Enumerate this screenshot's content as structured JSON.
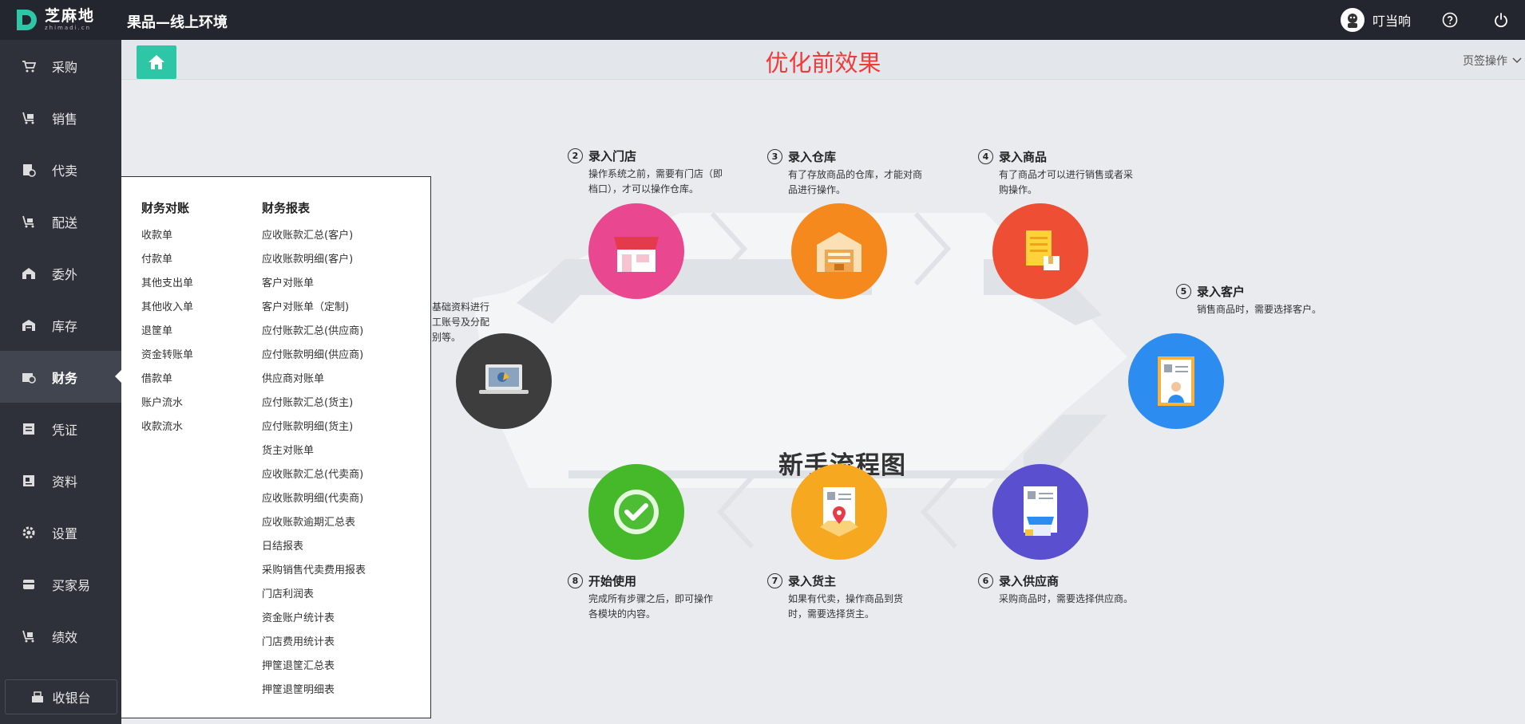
{
  "app": {
    "logo_cn": "芝麻地",
    "logo_en": "zhimadi.cn",
    "title": "果品—线上环境",
    "user_name": "叮当响",
    "accent_color": "#2dc6a7"
  },
  "sidebar": {
    "items": [
      {
        "label": "采购",
        "icon": "cart-icon"
      },
      {
        "label": "销售",
        "icon": "trolley-icon"
      },
      {
        "label": "代卖",
        "icon": "consign-icon"
      },
      {
        "label": "配送",
        "icon": "delivery-icon"
      },
      {
        "label": "委外",
        "icon": "outsource-icon"
      },
      {
        "label": "库存",
        "icon": "warehouse-icon"
      },
      {
        "label": "财务",
        "icon": "finance-icon",
        "active": true
      },
      {
        "label": "凭证",
        "icon": "voucher-icon"
      },
      {
        "label": "资料",
        "icon": "data-icon"
      },
      {
        "label": "设置",
        "icon": "gear-icon"
      },
      {
        "label": "买家易",
        "icon": "buyer-icon"
      },
      {
        "label": "绩效",
        "icon": "performance-icon"
      }
    ],
    "footer_label": "收银台"
  },
  "tabbar": {
    "heading": "优化前效果",
    "ops_label": "页签操作"
  },
  "finance_menu": {
    "col1": {
      "title": "财务对账",
      "items": [
        "收款单",
        "付款单",
        "其他支出单",
        "其他收入单",
        "退筐单",
        "资金转账单",
        "借款单",
        "账户流水",
        "收款流水"
      ]
    },
    "col2": {
      "title": "财务报表",
      "items": [
        "应收账款汇总(客户)",
        "应收账款明细(客户)",
        "客户对账单",
        "客户对账单（定制)",
        "应付账款汇总(供应商)",
        "应付账款明细(供应商)",
        "供应商对账单",
        "应付账款汇总(货主)",
        "应付账款明细(货主)",
        "货主对账单",
        "应收账款汇总(代卖商)",
        "应收账款明细(代卖商)",
        "应收账款逾期汇总表",
        "日结报表",
        "采购销售代卖费用报表",
        "门店利润表",
        "资金账户统计表",
        "门店费用统计表",
        "押筐退筐汇总表",
        "押筐退筐明细表"
      ]
    }
  },
  "flow": {
    "title": "新手流程图",
    "intro_text": "基础资料进行工账号及分配别等。",
    "steps": [
      {
        "num": "2",
        "title": "录入门店",
        "desc": "操作系统之前，需要有门店（即档口），才可以操作仓库。"
      },
      {
        "num": "3",
        "title": "录入仓库",
        "desc": "有了存放商品的仓库，才能对商品进行操作。"
      },
      {
        "num": "4",
        "title": "录入商品",
        "desc": "有了商品才可以进行销售或者采购操作。"
      },
      {
        "num": "5",
        "title": "录入客户",
        "desc": "销售商品时，需要选择客户。"
      },
      {
        "num": "6",
        "title": "录入供应商",
        "desc": "采购商品时，需要选择供应商。"
      },
      {
        "num": "7",
        "title": "录入货主",
        "desc": "如果有代卖，操作商品到货时，需要选择货主。"
      },
      {
        "num": "8",
        "title": "开始使用",
        "desc": "完成所有步骤之后，即可操作各模块的内容。"
      }
    ],
    "colors": {
      "start": "#3d3d3d",
      "store": "#e9478f",
      "warehouse": "#f5891e",
      "goods": "#ee4e34",
      "customer": "#2d8cf0",
      "supplier": "#5a4fcf",
      "owner": "#f6a821",
      "use": "#45b92a"
    }
  }
}
